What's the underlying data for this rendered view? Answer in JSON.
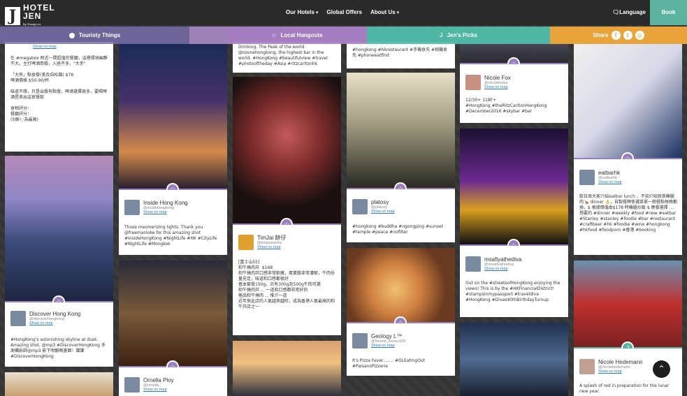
{
  "brand": {
    "logo_letter": "J",
    "name_line1": "HOTEL",
    "name_line2": "JEN",
    "sub": "By Shangri-La"
  },
  "nav": {
    "items": [
      {
        "label": "Our Hotels"
      },
      {
        "label": "Global Offers"
      },
      {
        "label": "About Us"
      }
    ],
    "language": "Language",
    "book": "Book"
  },
  "filters": {
    "touristy": "Touristy Things",
    "local": "Local Hangouts",
    "jens": "Jen's Picks",
    "share": "Share"
  },
  "icons": {
    "chevron": "chevron-down-icon",
    "star": "star-icon",
    "up": "arrow-up-icon",
    "share": [
      "facebook-icon",
      "twitter-icon",
      "instagram-icon"
    ]
  },
  "colors": {
    "purple": "#9a7fbf",
    "teal": "#5bb3a0",
    "orange": "#e9a33b"
  },
  "c1": {
    "show_on_map": "Show on map",
    "text": "在 #megabox 附近一間超值的餐廳，這裡環境幽靜不大，主打啤酒西餐，入座不多，\"大手\"\n\n「大有」點食餐(美及自松園) $78\n啤酒價格 $50-90/杯\n\n味道不錯，只是出餐有點慢，啤酒選擇很多，要喝啤酒是來出這家餐館\n\n食物評分：\n餐廳評分：\n(5個🐑為最高)"
  },
  "c2": {
    "name": "Discover Hong Kong",
    "handle": "@discoverhongkong",
    "show_on_map": "Show on map",
    "text": "#HongKong's astonishing skyline at dusk. Amazing shot, @mp3 #DiscoverHongKong 多謝攝影師@mp3 影下咁靚嘅畫面！讚讚 #DiscoverHongKong"
  },
  "c3": {
    "name": "Inside Hong Kong",
    "handle": "@insidehongkong",
    "show_on_map": "Show on map",
    "text": "Those mesmerizing lights. Thank you @freemanloke for this amazing shot #InsideHongKong #NightLife #HK #CityLife #NightLife #Mongkok"
  },
  "c4": {
    "name": "Ornella Ploy",
    "handle": "@ornella_",
    "show_on_map": "Show on map"
  },
  "c5": {
    "text": "Drinking. The Peak of the world @ozonehongkong, the highest bar in the world. #HongKong #beautifulview #travel #photooftheday #Asia #ritzcarltonhk"
  },
  "c6": {
    "name": "TimJai 餅仔",
    "handle": "@timjaisweety",
    "show_on_map": "Show on map",
    "text": "[富士山55]\n和牛燒肉丼  $168\n和牛燒肉丼口感非常軟嫩，蛋黃醬非常濃郁，牛肉份量充足，味道和口感都很好\n基本套餐150g，另有300g及500g牛肉可選\n和牛燒肉丼 ... 一道和口感都非常好的\n極品和牛燒肉 ... 推介一道\n近年來此店的人氣越來越旺，成為香港人氣最高的和牛丼店之一"
  },
  "c7": {
    "text": "#hongkong #hkrestaurant #手機食先 #相機食先 #phoneeatfirst"
  },
  "c8": {
    "name": "platosy",
    "handle": "@platosy",
    "show_on_map": "Show on map",
    "text": "#hongkong #buddha #ngongping #sunset #temple #peace #nofilter"
  },
  "c9": {
    "name": "Geology L™",
    "handle": "@lovehk_disney930",
    "show_on_map": "Show on map",
    "text": "It's Pizza Fever........ #GLEatingOut #PaisanoPizzeria"
  },
  "c10": {
    "name": "Nicole Fox",
    "handle": "@nicolefoxtw",
    "show_on_map": "Show on map",
    "text": "12/30+ 118F+\n#HongKong #theRitzCarltonHongKong #December2016 #skybar #bar"
  },
  "c11": {
    "name": "msafiyathediva",
    "handle": "@msafiyathediva",
    "show_on_map": "Show on map",
    "text": "Out on the #streetsofHongKong enjoying the views! This is by the #HKFinancialDistrict! #stampsinmypassport #traveldiva #HongKong #Divas40thBirthdayTurnup"
  },
  "c12": {
    "name": "eatbarhk",
    "handle": "@eatbarhk",
    "show_on_map": "Show on map",
    "text": "飲日周大家介紹eatbar lunch ，不如介紹就係雞腿肉🍗 dinner 👌，自製餐牌係選菜單一啲餐點每晚都換，$ 根據價值由$178 時雞腿炒飯 $ 晚餐選擇 ... 想要的 #dinner #weekly #food #new #eatbar #Stanley #stanley #foodie #bar #restaurant #craftbeer #hk #foodie #wine #hongkong #hkfood #foodporn #香港 #booking"
  },
  "c13": {
    "name": "Nicole Hedemann",
    "handle": "@nicolehedemann",
    "show_on_map": "Show on map",
    "text": "A splash of red in preparation for the lunar new year."
  }
}
